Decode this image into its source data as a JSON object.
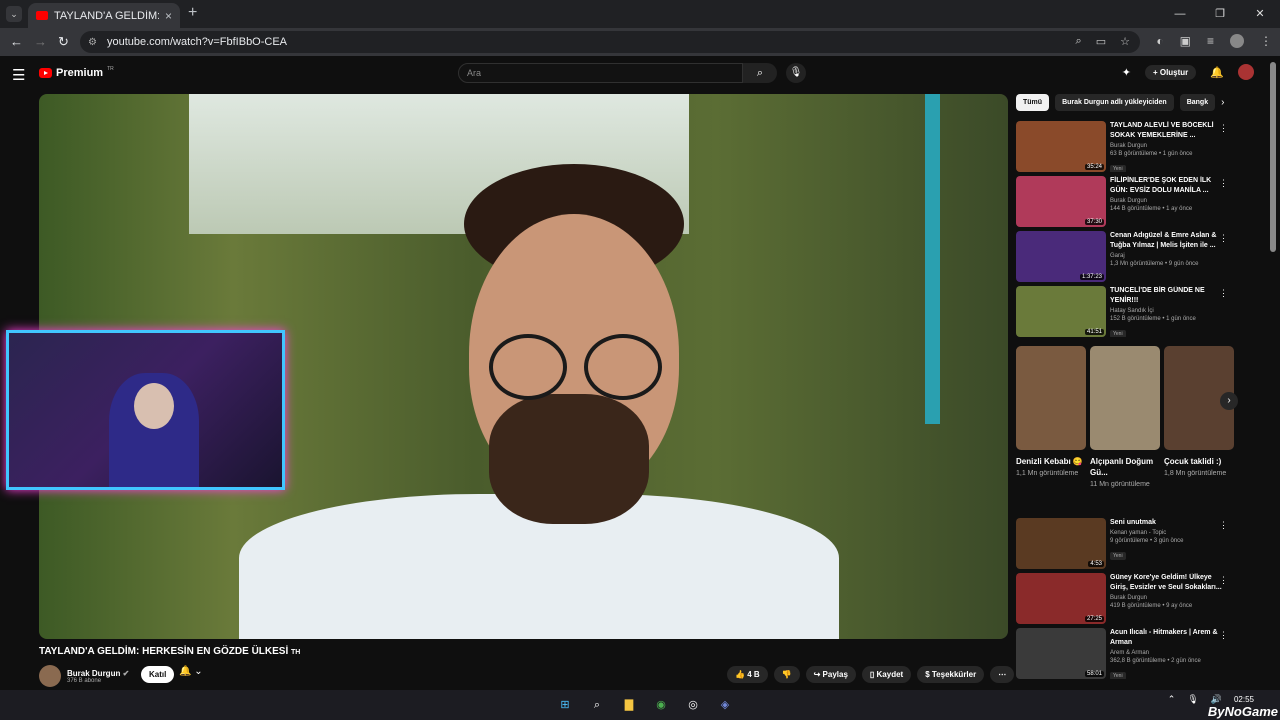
{
  "browser": {
    "tab_title": "TAYLAND'A GELDİM: HERKESİN",
    "url": "youtube.com/watch?v=FbfIBbO-CEA"
  },
  "youtube": {
    "logo_text": "Premium",
    "logo_region": "TR",
    "search_placeholder": "Ara",
    "create_label": "Oluştur"
  },
  "video": {
    "title": "TAYLAND'A GELDİM: HERKESİN EN GÖZDE ÜLKESİ",
    "title_flag": "TH",
    "channel": "Burak Durgun",
    "subscribers": "376 B abone",
    "join_label": "Katıl",
    "likes": "4 B",
    "share_label": "Paylaş",
    "save_label": "Kaydet",
    "thanks_label": "Teşekkürler"
  },
  "sidebar": {
    "chips": [
      "Tümü",
      "Burak Durgun adlı yükleyiciden",
      "Bangk"
    ],
    "videos_top": [
      {
        "title": "TAYLAND ALEVLİ VE BÖCEKLİ SOKAK YEMEKLERİNE ...",
        "channel": "Burak Durgun",
        "meta": "63 B görüntüleme • 1 gün önce",
        "badge": "Yeni",
        "duration": "35:24",
        "color": "#8a4a2a"
      },
      {
        "title": "FİLİPİNLER'DE ŞOK EDEN İLK GÜN: EVSİZ DOLU MANİLA ...",
        "channel": "Burak Durgun",
        "meta": "144 B görüntüleme • 1 ay önce",
        "badge": "",
        "duration": "37:30",
        "color": "#b03a5a"
      },
      {
        "title": "Cenan Adıgüzel & Emre Aslan & Tuğba Yılmaz | Melis İşiten ile ...",
        "channel": "Garaj",
        "meta": "1,3 Mn görüntüleme • 9 gün önce",
        "badge": "",
        "duration": "1:37:23",
        "color": "#4a2a7a"
      },
      {
        "title": "TUNCELİ'DE BİR GÜNDE NE YENİR!!!",
        "channel": "Hatay Sandık İçi",
        "meta": "152 B görüntüleme • 1 gün önce",
        "badge": "Yeni",
        "duration": "41:51",
        "color": "#6a7a3a"
      }
    ],
    "shorts": [
      {
        "title": "Denizli Kebabı 😋",
        "views": "1,1 Mn görüntüleme",
        "color": "#7a5a40"
      },
      {
        "title": "Alçıpanlı Doğum Gü...",
        "views": "11 Mn görüntüleme",
        "color": "#9a8a70"
      },
      {
        "title": "Çocuk taklidi :)",
        "views": "1,8 Mn görüntüleme",
        "color": "#5a4030"
      }
    ],
    "videos_bottom": [
      {
        "title": "Seni unutmak",
        "channel": "Kenan yaman - Topic",
        "meta": "9 görüntüleme • 3 gün önce",
        "badge": "Yeni",
        "duration": "4:53",
        "color": "#5a3a22"
      },
      {
        "title": "Güney Kore'ye Geldim! Ülkeye Giriş, Evsizler ve Seul Sokakları...",
        "channel": "Burak Durgun",
        "meta": "419 B görüntüleme • 9 ay önce",
        "badge": "",
        "duration": "27:25",
        "color": "#8a2a2a"
      },
      {
        "title": "Acun Ilıcalı - Hitmakers | Arem & Arman",
        "channel": "Arem & Arman",
        "meta": "362,8 B görüntüleme • 2 gün önce",
        "badge": "Yeni",
        "duration": "58:01",
        "color": "#3a3a3a"
      }
    ]
  },
  "taskbar": {
    "time": "02:55",
    "watermark": "ByNoGame"
  }
}
